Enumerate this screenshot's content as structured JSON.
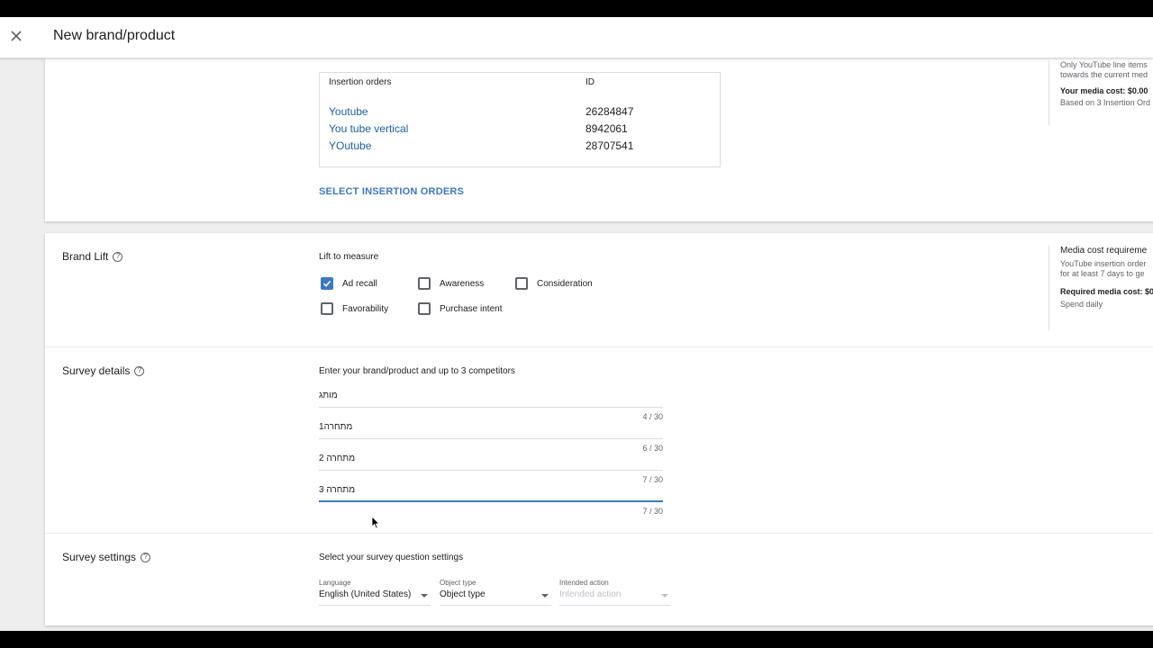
{
  "header": {
    "title": "New brand/product"
  },
  "insertion_orders": {
    "col_name": "Insertion orders",
    "col_id": "ID",
    "rows": [
      {
        "name": "Youtube",
        "id": "26284847"
      },
      {
        "name": "You tube vertical",
        "id": "8942061"
      },
      {
        "name": "YOutube",
        "id": "28707541"
      }
    ],
    "select_label": "SELECT INSERTION ORDERS"
  },
  "side_top": {
    "line1": "Only YouTube line items",
    "line2": "towards the current med",
    "cost_label": "Your media cost:",
    "cost_value": "$0.00",
    "based_on": "Based on 3 Insertion Ord"
  },
  "brand_lift": {
    "title": "Brand Lift",
    "lift_label": "Lift to measure",
    "options": [
      {
        "label": "Ad recall",
        "checked": true
      },
      {
        "label": "Awareness",
        "checked": false
      },
      {
        "label": "Consideration",
        "checked": false
      },
      {
        "label": "Favorability",
        "checked": false
      },
      {
        "label": "Purchase intent",
        "checked": false
      }
    ]
  },
  "side_brand": {
    "head": "Media cost requireme",
    "line1": "YouTube insertion order",
    "line2": "for at least 7 days to ge",
    "required_label": "Required media cost:",
    "required_value": "$0",
    "spend": "Spend daily"
  },
  "survey_details": {
    "title": "Survey details",
    "instruction": "Enter your brand/product and up to 3 competitors",
    "fields": [
      {
        "value": "מותג",
        "counter": "4 / 30"
      },
      {
        "value": "מתחרה1",
        "counter": "6 / 30"
      },
      {
        "value": "מתחרה 2",
        "counter": "7 / 30"
      },
      {
        "value": "מתחרה 3",
        "counter": "7 / 30"
      }
    ]
  },
  "survey_settings": {
    "title": "Survey settings",
    "instruction": "Select your survey question settings",
    "language_label": "Language",
    "language_value": "English (United States)",
    "object_label": "Object type",
    "object_value": "Object type",
    "action_label": "Intended action",
    "action_value": "Intended action"
  },
  "icons": {
    "close": "close-icon",
    "help": "help-circle-icon",
    "check": "check-icon",
    "dropdown": "caret-down-icon",
    "cursor": "mouse-cursor-icon"
  },
  "colors": {
    "accent": "#3b78c6",
    "link": "#1a5fa8",
    "background": "#eeeeee"
  }
}
